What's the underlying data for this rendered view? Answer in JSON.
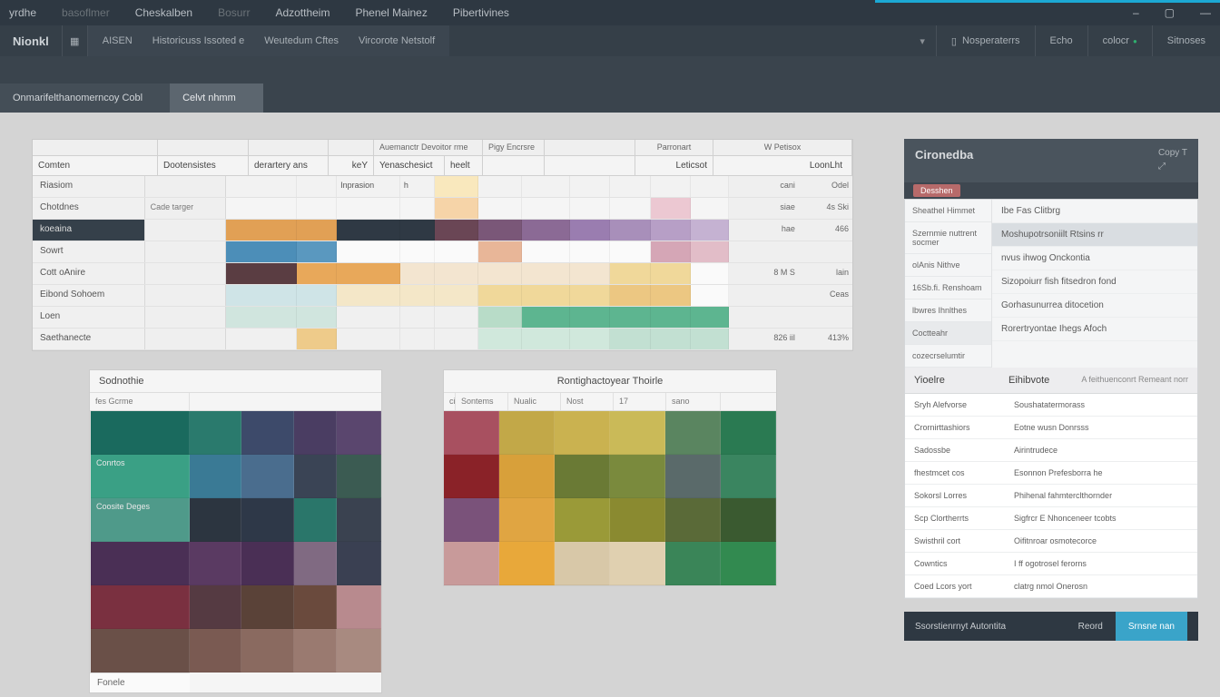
{
  "menu": [
    "yrdhe",
    "basoflmer",
    "Cheskalben",
    "Bosurr",
    "Adzottheim",
    "Phenel Mainez",
    "Pibertivines"
  ],
  "toolbar": {
    "home": "Nionkl",
    "group": [
      "AISEN",
      "Historicuss Issoted e",
      "Weutedum Cftes",
      "Vircorote Netstolf"
    ],
    "right": [
      "Nosperaterrs",
      "Echo",
      "colocr",
      "Sitnoses"
    ]
  },
  "tabs": [
    {
      "label": "Onmarifelthanomerncoy Cobl",
      "active": false
    },
    {
      "label": "Celvt nhmm",
      "active": true
    }
  ],
  "grid": {
    "h1": {
      "a": "Auemanctr Devoitor rme",
      "b": "Pigy Encrsre",
      "c": "Parronart",
      "d": "W Petisox"
    },
    "h2": [
      "Comten",
      "Dootensistes",
      "derartery ans",
      "keY",
      "Yenaschesict",
      "heelt",
      "Leticsot",
      "LoonLht"
    ],
    "rows": [
      {
        "label": "Riasiom",
        "sub": "",
        "v1": "Inprasion",
        "v2": "h",
        "r1": "cani",
        "r2": "Odel"
      },
      {
        "label": "Chotdnes",
        "sub": "Cade targer",
        "v1": "",
        "v2": "",
        "r1": "siae",
        "r2": "4s Ski"
      },
      {
        "label": "koeaina",
        "sub": "",
        "v1": "",
        "v2": "",
        "r1": "hae",
        "r2": "466"
      },
      {
        "label": "Sowrt",
        "sub": "",
        "v1": "",
        "v2": "",
        "r1": "",
        "r2": ""
      },
      {
        "label": "Cott oAnire",
        "sub": "",
        "v1": "",
        "v2": "",
        "r1": "8 M S",
        "r2": "lain"
      },
      {
        "label": "Eibond Sohoem",
        "sub": "",
        "v1": "",
        "v2": "",
        "r1": "",
        "r2": "Ceas"
      },
      {
        "label": "Loen",
        "sub": "",
        "v1": "",
        "v2": "",
        "r1": "",
        "r2": ""
      },
      {
        "label": "Saethanecte",
        "sub": "",
        "v1": "",
        "v2": "",
        "r1": "826 iil",
        "r2": "413%"
      }
    ],
    "row_colors": [
      [
        "#f2f2f2",
        "#f2f2f2",
        "#f2f2f2",
        "#f2f2f2",
        "#f9e8bd",
        "#f2f2f2",
        "#f2f2f2",
        "#f2f2f2",
        "#f2f2f2",
        "#f2f2f2",
        "#f2f2f2"
      ],
      [
        "#f5f5f5",
        "#f5f5f5",
        "#f5f5f5",
        "#f5f5f5",
        "#f6d4a8",
        "#f5f5f5",
        "#f5f5f5",
        "#f5f5f5",
        "#f5f5f5",
        "#ecc8d2",
        "#f5f5f5"
      ],
      [
        "#e1a055",
        "#e1a055",
        "#2f3944",
        "#2f3944",
        "#6a4655",
        "#7a5778",
        "#8b6a95",
        "#9a7db0",
        "#a88fba",
        "#b79fc6",
        "#c5b2d2"
      ],
      [
        "#4c8eb8",
        "#5a98bf",
        "#fafafa",
        "#fafafa",
        "#fafafa",
        "#e8b698",
        "#fafafa",
        "#fafafa",
        "#fafafa",
        "#d5a6b6",
        "#e2bdc8"
      ],
      [
        "#5a3d42",
        "#e8a85a",
        "#e8a85a",
        "#f3e5d0",
        "#f3e5d0",
        "#f3e5d0",
        "#f3e5d0",
        "#f3e5d0",
        "#f0d89a",
        "#f0d89a",
        "#fafafa"
      ],
      [
        "#cfe4e7",
        "#cfe4e7",
        "#f4e7c8",
        "#f4e7c8",
        "#f4e7c8",
        "#f0d89a",
        "#f0d89a",
        "#f0d89a",
        "#ecc782",
        "#ecc782",
        "#fafafa"
      ],
      [
        "#d0e5de",
        "#d0e5de",
        "#f0f0f0",
        "#f0f0f0",
        "#f0f0f0",
        "#b8dcc8",
        "#5db590",
        "#5db590",
        "#5db590",
        "#5db590",
        "#5db590"
      ],
      [
        "#f0f0f0",
        "#eecb8a",
        "#f0f0f0",
        "#f0f0f0",
        "#f0f0f0",
        "#d0e8dc",
        "#d0e8dc",
        "#d0e8dc",
        "#c2e0d2",
        "#c2e0d2",
        "#c2e0d2"
      ]
    ]
  },
  "palette_a": {
    "title": "Sodnothie",
    "header": "fes Gcrme",
    "row_labels": [
      "",
      "Conrtos",
      "Coosite Deges",
      "",
      "",
      ""
    ],
    "footer": "Fonele",
    "colors": [
      [
        "#1a6a5e",
        "#2a7a6d",
        "#3d4a6a",
        "#4a3d62",
        "#5a466e"
      ],
      [
        "#3aa085",
        "#3a7a95",
        "#4a6d8e",
        "#3a4455",
        "#3b5b52"
      ],
      [
        "#4f9a8a",
        "#2c3540",
        "#2e3848",
        "#2a766a",
        "#3a4250"
      ],
      [
        "#4a2f55",
        "#5a3a62",
        "#4a2f55",
        "#806a82",
        "#3a4052"
      ],
      [
        "#7a3040",
        "#553a42",
        "#5a4238",
        "#6a4a3d",
        "#b88a8e"
      ],
      [
        "#6a5048",
        "#7a5a52",
        "#8a6a60",
        "#9a7a70",
        "#a88a80"
      ]
    ]
  },
  "palette_b": {
    "title": "Rontighactoyear Thoirle",
    "headers": [
      "ci",
      "Sontems",
      "Nualic",
      "Nost",
      "17",
      "sano"
    ],
    "colors": [
      [
        "#a85060",
        "#c2a848",
        "#cab250",
        "#caba58",
        "#5a8560",
        "#2a7a52"
      ],
      [
        "#8a2228",
        "#d8a03a",
        "#6a7a35",
        "#7a8a3d",
        "#5a6a6a",
        "#3a8560"
      ],
      [
        "#7a527a",
        "#e0a542",
        "#9a9a38",
        "#8a8a30",
        "#5a6a38",
        "#3a5a30"
      ],
      [
        "#c89a9a",
        "#e8a83a",
        "#d8c8a8",
        "#e0d0b0",
        "#3a8558",
        "#328a50"
      ]
    ]
  },
  "side": {
    "title": "Cironedba",
    "corner": "Copy T",
    "chip": "Desshen",
    "left_items": [
      "Sheathel Himmet",
      "Szernmie nuttrent socmer",
      "olAnis Nithve",
      "16Sb.fi. Renshoam",
      "lbwres Ihnlthes",
      "Coctteahr",
      "cozecrselumtir"
    ],
    "right_items": [
      "Ibe Fas Clitbrg",
      "Moshupotrsoniilt Rtsins rr",
      "nvus ihwog Onckontia",
      "Sizopoiurr fish fitsedron fond",
      "Gorhasunurrea ditocetion",
      "Rorertryontae Ihegs Afoch"
    ],
    "section": {
      "a": "Yioelre",
      "b": "Eihibvote",
      "r": "A feithuenconrt   Remeant norr"
    },
    "rows": [
      {
        "l": "Sryh Alefvorse",
        "m": "Soushatatermorass"
      },
      {
        "l": "Crornirttashiors",
        "m": "Eotne wusn Donrsss"
      },
      {
        "l": "Sadossbe",
        "m": "Airintrudece"
      },
      {
        "l": "fhestmcet cos",
        "m": "Esonnon Prefesborra he"
      },
      {
        "l": "Sokorsl Lorres",
        "m": "Phihenal fahmterclthornder"
      },
      {
        "l": "Scp Clortherrts",
        "m": "Sigfrcr E Nhonceneer tcobts"
      },
      {
        "l": "Swisthril cort",
        "m": "Oifitnroar osmotecorce"
      },
      {
        "l": "Cowntics",
        "m": "I ff ogotrosel ferorns"
      },
      {
        "l": "Coed Lcors yort",
        "m": "clatrg nmol Onerosn"
      }
    ],
    "footer": {
      "l": "Ssorstienrnyt   Autontita",
      "b1": "Reord",
      "b2": "Srnsne nan"
    }
  }
}
